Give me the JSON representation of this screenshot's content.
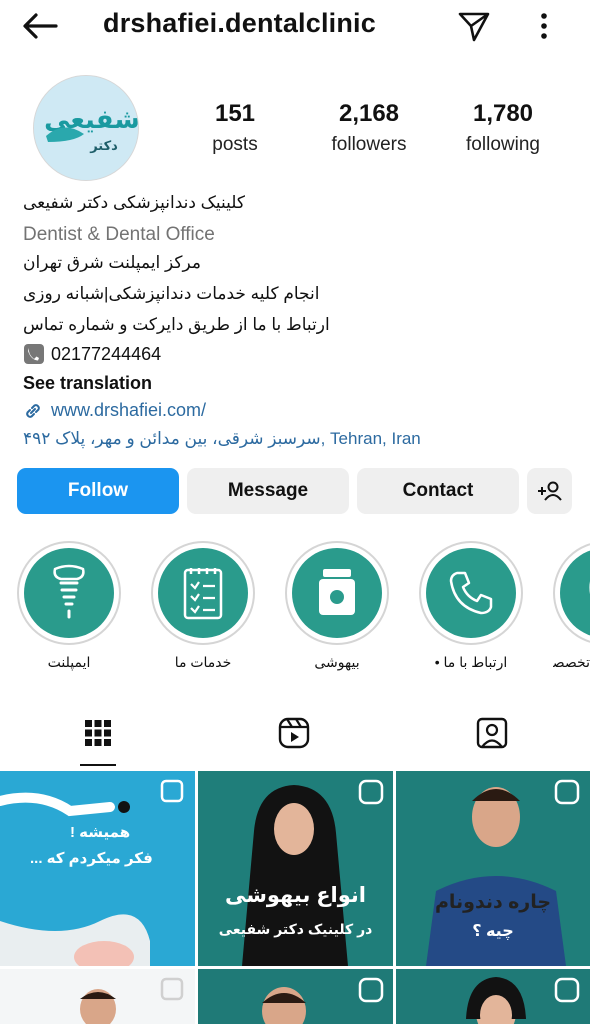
{
  "header": {
    "username": "drshafiei.dentalclinic",
    "icons": [
      "back-arrow-icon",
      "send-icon",
      "more-vertical-icon"
    ]
  },
  "profile": {
    "avatar_text": [
      "شفیعی",
      "دکتر"
    ],
    "stats": [
      {
        "value": "151",
        "label": "posts"
      },
      {
        "value": "2,168",
        "label": "followers"
      },
      {
        "value": "1,780",
        "label": "following"
      }
    ]
  },
  "bio": {
    "name": "کلینیک دندانپزشکی دکتر شفیعی",
    "category": "Dentist & Dental Office",
    "lines": [
      "مرکز ایمپلنت شرق تهران",
      "انجام کلیه خدمات دندانپزشکی|شبانه روزی",
      "ارتباط با ما از طریق دایرکت و شماره تماس"
    ],
    "phone": "02177244464",
    "see_translation": "See translation",
    "website": "www.drshafiei.com/",
    "address": "سرسبز شرقی، بین مدائن و مهر، پلاک ۴۹۲, Tehran, Iran"
  },
  "actions": {
    "follow": "Follow",
    "message": "Message",
    "contact": "Contact"
  },
  "highlights": [
    {
      "label": "ایمپلنت",
      "icon": "implant-icon"
    },
    {
      "label": "خدمات ما",
      "icon": "checklist-icon"
    },
    {
      "label": "بیهوشی",
      "icon": "medicine-jar-icon"
    },
    {
      "label": "ارتباط با ما •",
      "icon": "phone-icon"
    },
    {
      "label": "تخصصی •",
      "icon": "tooth-icon"
    }
  ],
  "tabs": [
    "grid-icon",
    "reels-icon",
    "tagged-icon"
  ],
  "grid_posts": [
    {
      "text_line1": "همیشه !",
      "text_line2": "فکر میکردم که ..."
    },
    {
      "text_line1": "انواع بیهوشی",
      "text_line2": "در کلینیک دکتر شفیعی"
    },
    {
      "text_line1": "چاره دندونام",
      "text_line2": "چیه ؟"
    }
  ],
  "colors": {
    "follow_bg": "#1b95f0",
    "secondary_btn_bg": "#efefef",
    "link": "#2c6aa0",
    "highlight_bg": "#2a9b8c"
  }
}
